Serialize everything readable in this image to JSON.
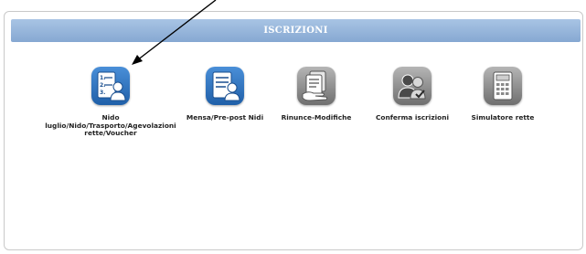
{
  "panel": {
    "title": "ISCRIZIONI"
  },
  "tiles": [
    {
      "label": "Nido\nluglio/Nido/Trasporto/Agevolazioni\nrette/Voucher",
      "icon": "numbered-list-person-icon",
      "color": "#2f6fb6"
    },
    {
      "label": "Mensa/Pre-post Nidi",
      "icon": "document-person-icon",
      "color": "#2f6fb6"
    },
    {
      "label": "Rinunce-Modifiche",
      "icon": "documents-hand-icon",
      "color": "#8a8a8a"
    },
    {
      "label": "Conferma iscrizioni",
      "icon": "people-check-icon",
      "color": "#8a8a8a"
    },
    {
      "label": "Simulatore rette",
      "icon": "calculator-icon",
      "color": "#8a8a8a"
    }
  ]
}
